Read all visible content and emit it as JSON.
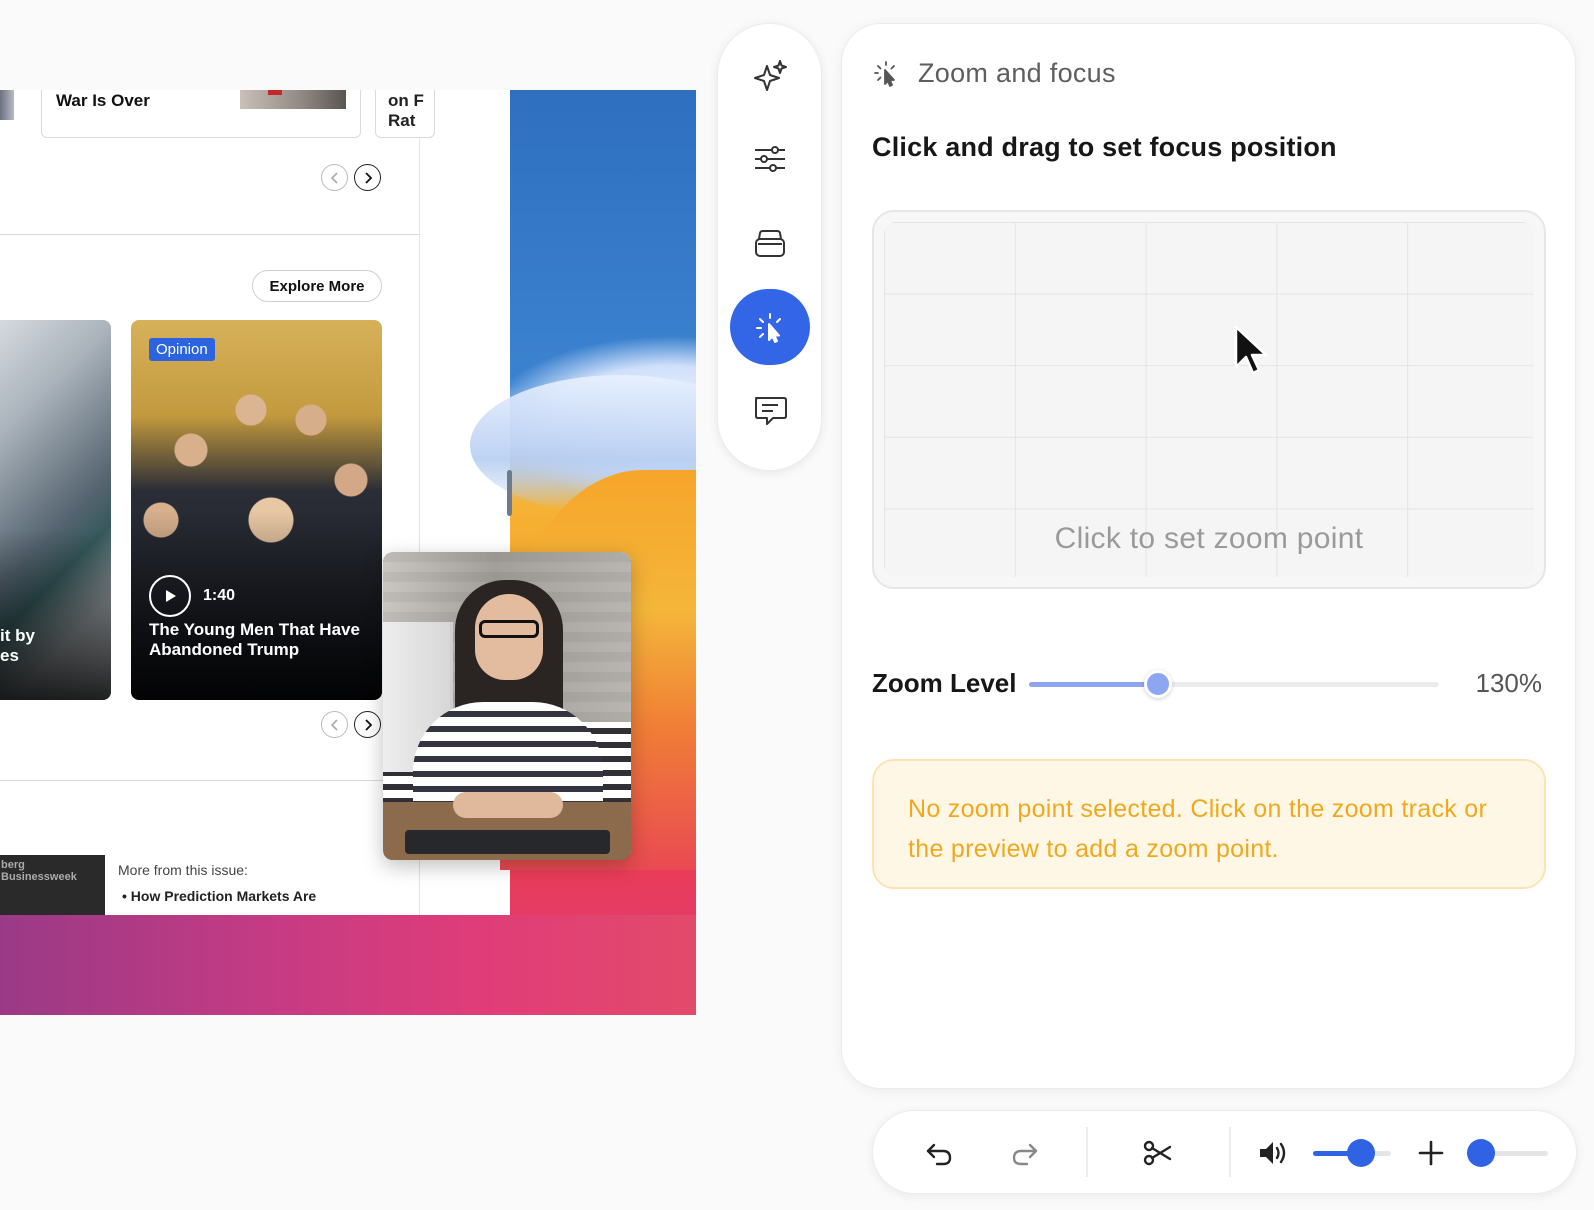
{
  "preview": {
    "top_cards": {
      "card1_text": "War Is Over",
      "card3_line1": "on F",
      "card3_line2": "Rat"
    },
    "explore_button": "Explore More",
    "story_left_caption_line1": "it by",
    "story_left_caption_line2": "es",
    "story_right": {
      "badge": "Opinion",
      "duration": "1:40",
      "title": "The Young Men That Have Abandoned Trump"
    },
    "magazine_thumb": "berg Businessweek",
    "more_from_issue": "More from this issue:",
    "more_item": "• How Prediction Markets Are"
  },
  "rail": {
    "items": [
      {
        "name": "sparkles-icon",
        "active": false
      },
      {
        "name": "sliders-icon",
        "active": false
      },
      {
        "name": "layers-icon",
        "active": false
      },
      {
        "name": "zoom-cursor-icon",
        "active": true
      },
      {
        "name": "comment-icon",
        "active": false
      }
    ],
    "active_color": "#3266e6"
  },
  "panel": {
    "title": "Zoom and focus",
    "instruction": "Click and drag to set focus position",
    "grid_hint": "Click to set zoom point",
    "zoom_label": "Zoom Level",
    "zoom_value_text": "130%",
    "zoom_slider_fraction": 0.315,
    "notice": "No zoom point selected. Click on the zoom track or the preview to add a zoom point.",
    "notice_color": "#f0a91e"
  },
  "toolbar": {
    "items": [
      "undo-icon",
      "redo-icon",
      "scissors-icon",
      "volume-icon",
      "plus-icon"
    ],
    "volume_fraction": 0.62,
    "timeline_zoom_fraction": 0.1,
    "accent_color": "#2f63e4"
  }
}
